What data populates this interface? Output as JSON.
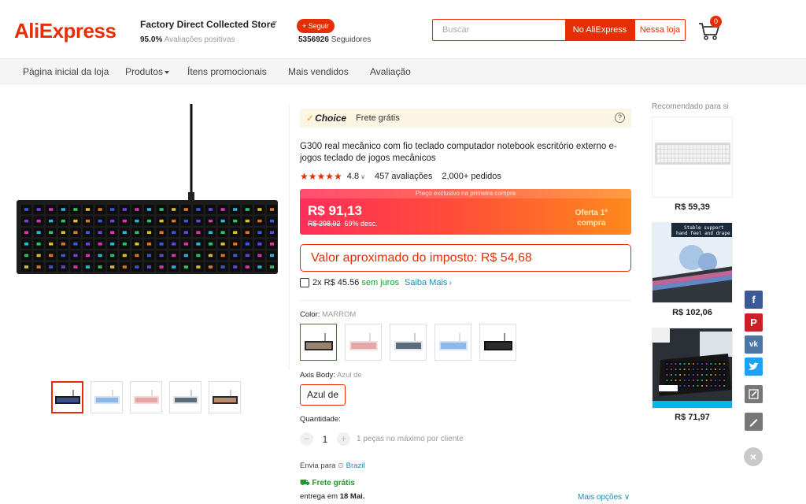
{
  "header": {
    "logo": "AliExpress",
    "store_name": "Factory Direct Collected Store",
    "rating_percent": "95.0%",
    "rating_text": "Avaliações positivas",
    "follow_label": "+ Seguir",
    "followers_count": "5356926",
    "followers_text": "Seguidores",
    "search_placeholder": "Buscar",
    "search_ali_label": "No AliExpress",
    "search_store_label": "Nessa loja",
    "cart_count": "0"
  },
  "nav": {
    "items": [
      "Página inicial da loja",
      "Produtos",
      "Ítens promocionais",
      "Mais vendidos",
      "Avaliação"
    ]
  },
  "product": {
    "choice_label": "Choice",
    "choice_text": "Frete grátis",
    "title": "G300 real mecânico com fio teclado computador notebook escritório externo e-jogos teclado de jogos mecânicos",
    "rating_value": "4.8",
    "reviews": "457 avaliações",
    "orders": "2,000+ pedidos",
    "price_banner": "Preço exclusivo na primeira compra",
    "price": "R$ 91,13",
    "price_old": "R$ 298,92",
    "discount": "69% desc.",
    "offer_line1": "Oferta 1ª",
    "offer_line2": "compra",
    "tax_text": "Valor aproximado do imposto: R$ 54,68",
    "installment": "2x R$ 45.56",
    "installment_interest": "sem juros",
    "installment_link": "Saiba Mais",
    "color_label": "Color:",
    "color_value": "MARROM",
    "axis_label": "Axis Body:",
    "axis_value": "Azul de",
    "axis_chip": "Azul de",
    "qty_label": "Quantidade:",
    "qty_value": "1",
    "qty_minus": "−",
    "qty_plus": "+",
    "qty_note": "1 peças no máximo por cliente",
    "ship_label": "Envia para",
    "ship_location": "Brazil",
    "free_shipping": "Frete grátis",
    "delivery_prefix": "entrega em",
    "delivery_date": "18 Mai.",
    "more_options": "Mais opções"
  },
  "recommended": {
    "title": "Recomendado para si",
    "items": [
      {
        "price": "R$ 59,39"
      },
      {
        "price": "R$ 102,06",
        "banner_line1": "Stable support",
        "banner_line2": "hand feel and drape"
      },
      {
        "price": "R$ 71,97"
      }
    ]
  },
  "share": {
    "facebook": "f",
    "pinterest": "P",
    "vk": "vk"
  },
  "colors": {
    "brand": "#e62e04",
    "facebook": "#3b5998",
    "pinterest": "#cb2027",
    "vk": "#4c75a3",
    "twitter": "#1da1f2",
    "share_gray": "#777777"
  }
}
